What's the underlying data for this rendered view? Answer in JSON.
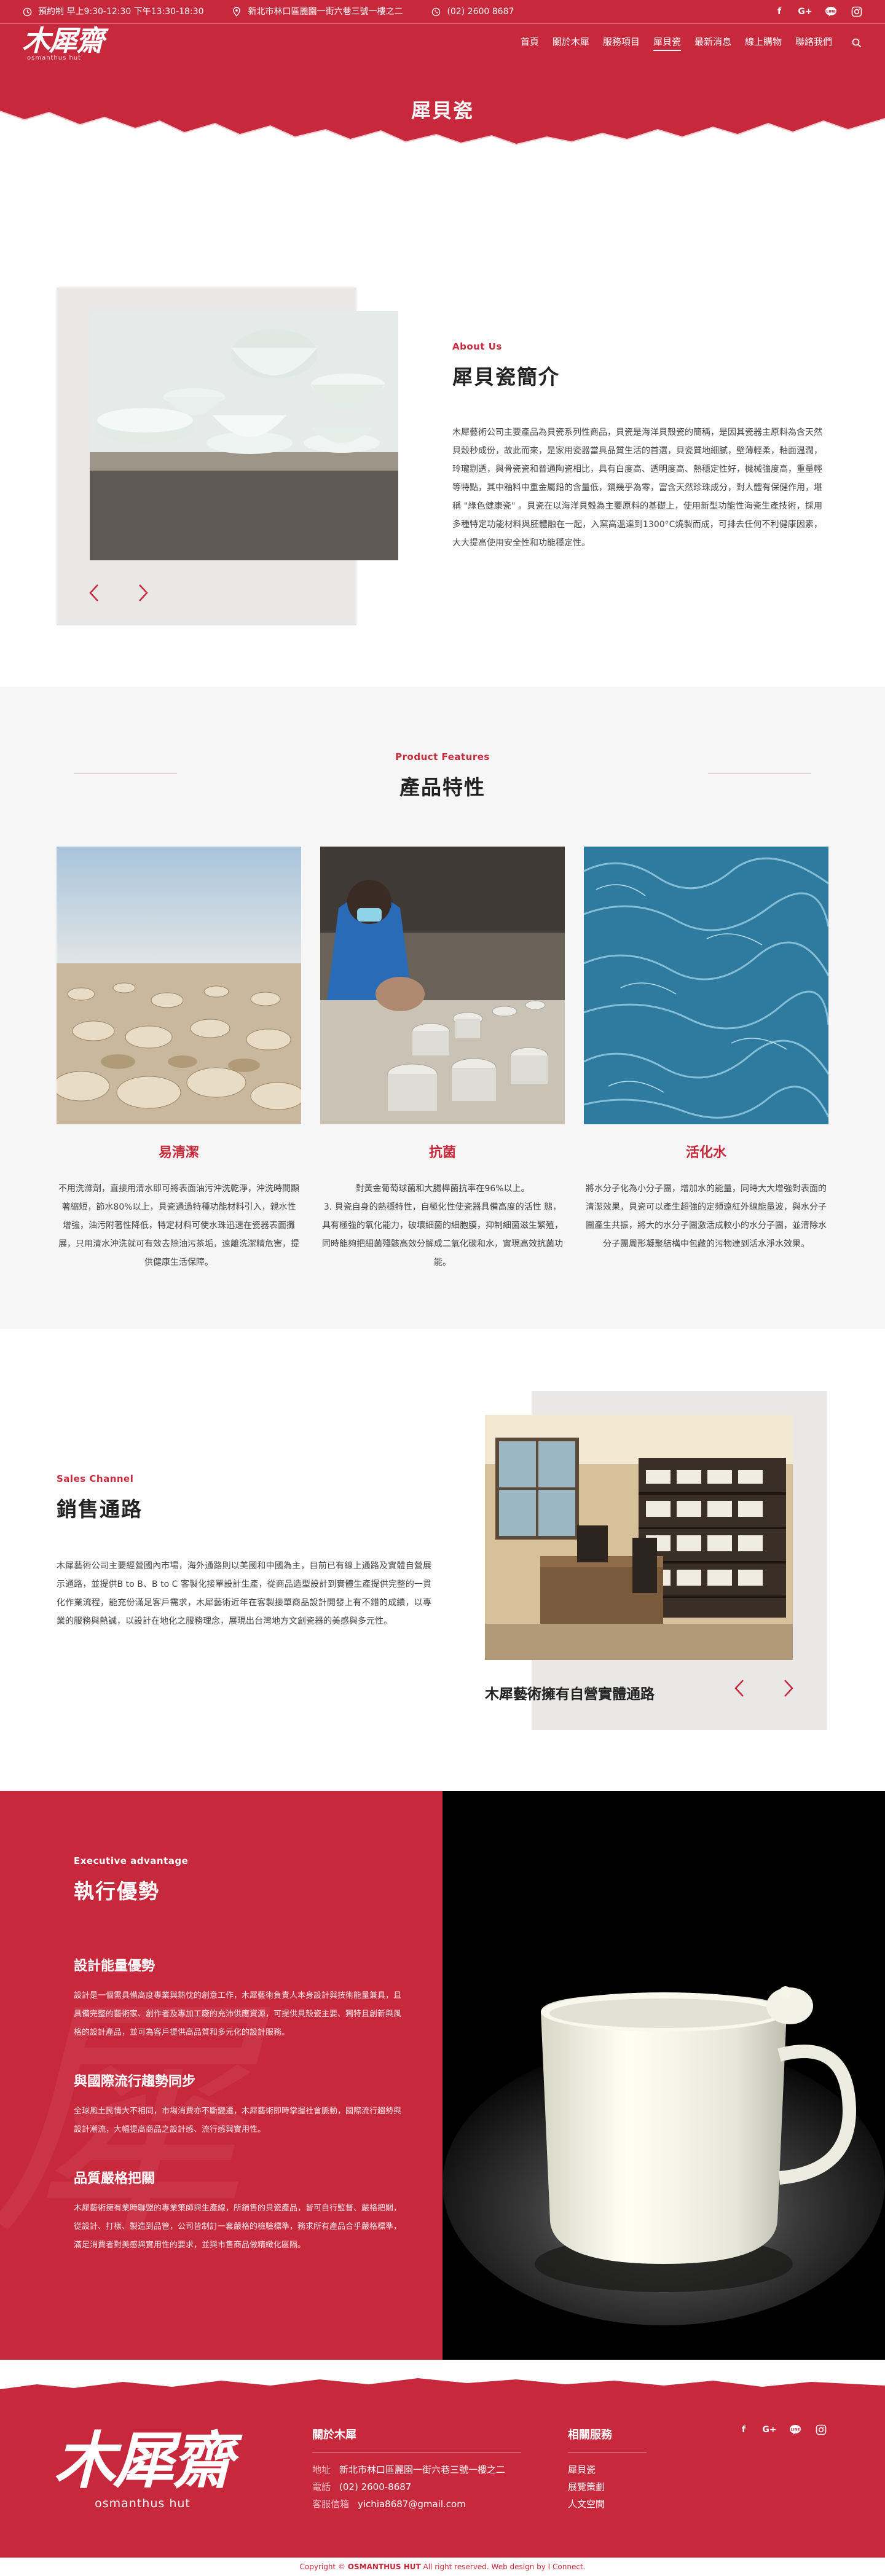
{
  "header": {
    "hours": "預約制 早上9:30-12:30 下午13:30-18:30",
    "address": "新北市林口區麗園一街六巷三號一樓之二",
    "phone": "(02) 2600 8687",
    "social_icons": [
      "facebook-icon",
      "google-plus-icon",
      "line-icon",
      "instagram-icon"
    ],
    "social_labels": {
      "facebook": "f",
      "google": "G+",
      "line": "…",
      "instagram": "◎"
    },
    "logo_text": "木犀齋",
    "logo_sub": "osmanthus hut",
    "nav": [
      "首頁",
      "關於木犀",
      "服務項目",
      "犀貝瓷",
      "最新消息",
      "線上購物",
      "聯絡我們"
    ],
    "active_nav": "犀貝瓷",
    "page_title": "犀貝瓷"
  },
  "about": {
    "eyebrow": "About Us",
    "title": "犀貝瓷簡介",
    "body": "木犀藝術公司主要產品為貝瓷系列性商品，貝瓷是海洋貝殼瓷的簡稱，是因其瓷器主原料為含天然貝殼秒成份，故此而來，是家用瓷器當具品質生活的首選，貝瓷質地細膩，壁薄輕柔，釉面温潤，玲瓏剔透，與骨瓷瓷和普通陶瓷相比，具有白度高、透明度高、熱穩定性好，機械強度高，重量輕等特點，其中釉料中重金屬鉛的含量低，鎘幾乎為零，富含天然珍珠成分，對人體有保健作用，堪稱 \"綠色健康瓷\" 。貝瓷在以海洋貝殼為主要原料的基礎上，使用新型功能性海瓷生產技術，採用多種特定功能材料與胚體融在一起，入窯高溫達到1300°C燒製而成，可排去任何不利健康因素，大大提高使用安全性和功能穩定性。"
  },
  "features": {
    "eyebrow": "Product Features",
    "title": "產品特性",
    "items": [
      {
        "title": "易清潔",
        "text": "不用洗滌劑，直接用清水即可將表面油污沖洗乾淨，沖洗時間顯著縮短，節水80%以上，貝瓷通過特種功能材料引入，親水性增強，油污附著性降低，特定材料可使水珠迅速在瓷器表面攤展，只用清水沖洗就可有效去除油污茶垢，遠離洗潔精危害，提供健康生活保障。"
      },
      {
        "title": "抗菌",
        "text": "對黃金葡萄球菌和大腸桿菌抗率在96%以上。\n3.  貝瓷自身的熱穩特性，自極化性使瓷器具備高度的活性 態，具有極強的氧化能力，破壞細菌的細胞膜，抑制細菌滋生繁殖，同時能夠把細菌殘骸高效分解成二氧化碳和水，實現高效抗菌功能。"
      },
      {
        "title": "活化水",
        "text": "將水分子化為小分子團，增加水的能量，同時大大增強對表面的清潔效果，貝瓷可以產生超強的定頻遠紅外線能量波，與水分子團產生共振，將大的水分子團激活成較小的水分子團，並清除水分子團周形凝聚結構中包藏的污物達到活水淨水效果。"
      }
    ]
  },
  "sales": {
    "eyebrow": "Sales Channel",
    "title": "銷售通路",
    "body": "木犀藝術公司主要經營國內市場，海外通路則以美國和中國為主，目前已有線上通路及實體自營展示通路，並提供B to B、B to C 客製化接單設計生產，從商品造型設計到實體生產提供完整的一貫化作業流程，能充份滿足客戶需求，木犀藝術近年在客製接單商品設計開發上有不錯的成績，以專業的服務與熱誠，以設計在地化之服務理念，展現出台灣地方文創瓷器的美感與多元性。",
    "caption": "木犀藝術擁有自營實體通路"
  },
  "exec": {
    "eyebrow": "Executive advantage",
    "title": "執行優勢",
    "items": [
      {
        "title": "設計能量優勢",
        "text": "設計是一個需具備高度專業與熱忱的創意工作，木犀藝術負責人本身設計與技術能量兼具，且具備完整的藝術家、創作者及專加工廠的充沛供應資源，可提供貝殼瓷主要、獨特且創新與風格的設計產品，並可為客戶提供高品質和多元化的設計服務。"
      },
      {
        "title": "與國際流行趨勢同步",
        "text": "全球風土民情大不相同，市場消費亦不斷變遷，木犀藝術即時掌握社會脈動，國際流行趨勢與設計潮流，大幅提高商品之設計感、流行感與實用性。"
      },
      {
        "title": "品質嚴格把關",
        "text": "木犀藝術擁有業時聯盟的專業策師與生產線，所銷售的貝瓷產品，皆可自行監督、嚴格把關，從設計、打樣、製造到品管，公司皆制訂一套嚴格的檢驗標準，務求所有產品合乎嚴格標準，滿足消費者對美感與實用性的要求，並與市售商品做精緻化區隔。"
      }
    ]
  },
  "footer": {
    "logo_text": "木犀齋",
    "logo_sub": "osmanthus hut",
    "about_title": "關於木犀",
    "address_label": "地址",
    "address": "新北市林口區麗園一街六巷三號一樓之二",
    "phone_label": "電話",
    "phone": "(02) 2600-8687",
    "email_label": "客服信箱",
    "email": "yichia8687@gmail.com",
    "services_title": "相關服務",
    "services": [
      "犀貝瓷",
      "展覽策劃",
      "人文空間"
    ],
    "copyright_pre": "Copyright ©",
    "copyright_brand": "OSMANTHUS HUT",
    "copyright_post": "All right reserved. Web design by I Connect."
  },
  "colors": {
    "brand_red": "#c8283c",
    "grey_panel": "#eae8e7"
  }
}
